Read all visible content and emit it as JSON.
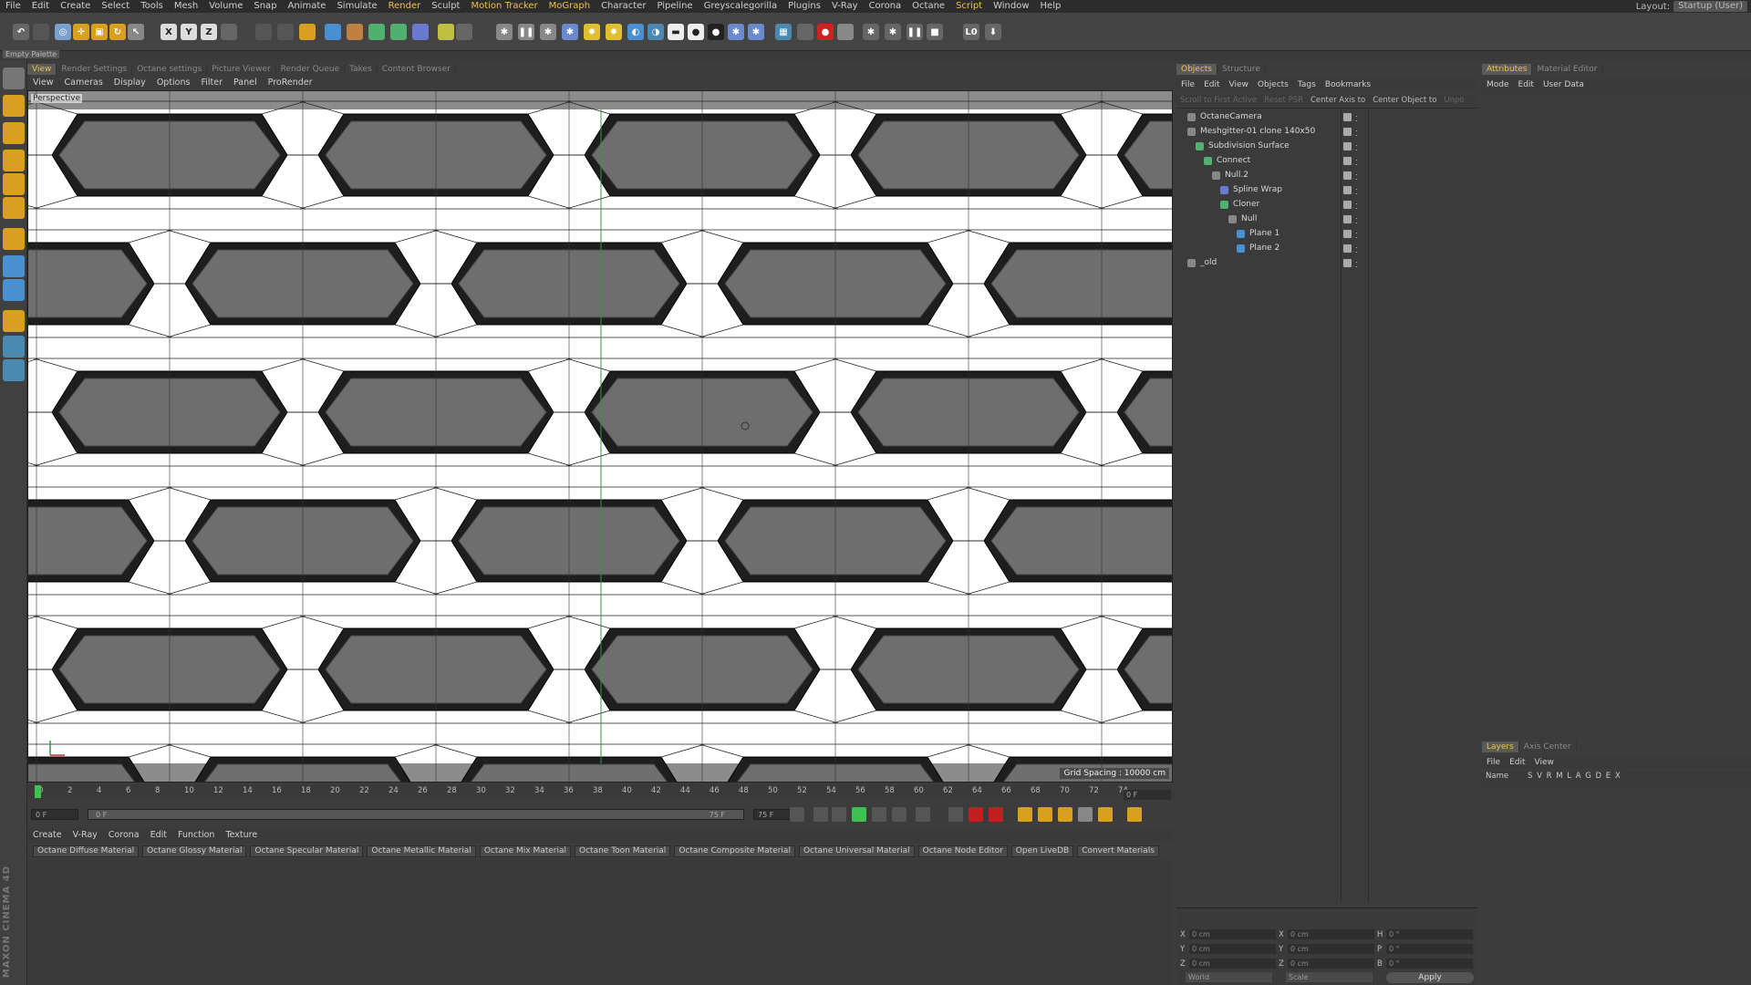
{
  "menubar": {
    "items": [
      "File",
      "Edit",
      "Create",
      "Select",
      "Tools",
      "Mesh",
      "Volume",
      "Snap",
      "Animate",
      "Simulate",
      "Render",
      "Sculpt",
      "Motion Tracker",
      "MoGraph",
      "Character",
      "Pipeline",
      "Greyscalegorilla",
      "Plugins",
      "V-Ray",
      "Corona",
      "Octane",
      "Script",
      "Window",
      "Help"
    ],
    "highlighted": [
      "Render",
      "Motion Tracker",
      "MoGraph",
      "Script"
    ],
    "layout_label": "Layout:",
    "layout_value": "Startup (User)"
  },
  "toolbar": {
    "axis_x": "X",
    "axis_y": "Y",
    "axis_z": "Z",
    "lock_label": "L0"
  },
  "palette": {
    "label": "Empty Palette"
  },
  "viewport": {
    "tabs": [
      "View",
      "Render Settings",
      "Octane settings",
      "Picture Viewer",
      "Render Queue",
      "Takes",
      "Content Browser"
    ],
    "active_tab": "View",
    "menu": [
      "View",
      "Cameras",
      "Display",
      "Options",
      "Filter",
      "Panel",
      "ProRender"
    ],
    "camera_label": "Perspective",
    "grid_info": "Grid Spacing : 10000 cm"
  },
  "timeline": {
    "ticks": [
      "0",
      "2",
      "4",
      "6",
      "8",
      "10",
      "12",
      "14",
      "16",
      "18",
      "20",
      "22",
      "24",
      "26",
      "28",
      "30",
      "32",
      "34",
      "36",
      "38",
      "40",
      "42",
      "44",
      "46",
      "48",
      "50",
      "52",
      "54",
      "56",
      "58",
      "60",
      "62",
      "64",
      "66",
      "68",
      "70",
      "72",
      "74"
    ],
    "current_frame": "0 F",
    "start_frame": "0 F",
    "slider_start": "0 F",
    "slider_end": "75 F",
    "end_frame": "75 F",
    "right_frame": "0 F"
  },
  "material": {
    "tabs": [
      "Create",
      "V-Ray",
      "Corona",
      "Edit",
      "Function",
      "Texture"
    ],
    "buttons": [
      "Octane Diffuse Material",
      "Octane Glossy Material",
      "Octane Specular Material",
      "Octane Metallic Material",
      "Octane Mix Material",
      "Octane Toon Material",
      "Octane Composite Material",
      "Octane Universal Material",
      "Octane Node Editor",
      "Open LiveDB",
      "Convert Materials"
    ]
  },
  "objects": {
    "tabs": [
      "Objects",
      "Structure"
    ],
    "active_tab": "Objects",
    "menu": [
      "File",
      "Edit",
      "View",
      "Objects",
      "Tags",
      "Bookmarks"
    ],
    "tools": [
      "Scroll to First Active",
      "Reset PSR",
      "Center Axis to",
      "Center Object to",
      "Unpo"
    ],
    "tree": [
      {
        "name": "OctaneCamera",
        "depth": 0,
        "icon": "camera-icon"
      },
      {
        "name": "Meshgitter-01 clone 140x50",
        "depth": 0,
        "icon": "null-icon"
      },
      {
        "name": "Subdivision Surface",
        "depth": 1,
        "icon": "subdivision-icon"
      },
      {
        "name": "Connect",
        "depth": 2,
        "icon": "connect-icon"
      },
      {
        "name": "Null.2",
        "depth": 3,
        "icon": "null-icon"
      },
      {
        "name": "Spline Wrap",
        "depth": 4,
        "icon": "spline-wrap-icon"
      },
      {
        "name": "Cloner",
        "depth": 4,
        "icon": "cloner-icon"
      },
      {
        "name": "Null",
        "depth": 5,
        "icon": "null-icon"
      },
      {
        "name": "Plane 1",
        "depth": 6,
        "icon": "plane-icon"
      },
      {
        "name": "Plane 2",
        "depth": 6,
        "icon": "plane-icon"
      },
      {
        "name": "_old",
        "depth": 0,
        "icon": "null-icon"
      }
    ]
  },
  "coords": {
    "pos_x": "0 cm",
    "pos_y": "0 cm",
    "pos_z": "0 cm",
    "size_x": "0 cm",
    "size_y": "0 cm",
    "size_z": "0 cm",
    "rot_h": "0 °",
    "rot_p": "0 °",
    "rot_b": "0 °",
    "mode_world": "World",
    "mode_scale": "Scale",
    "apply": "Apply",
    "lbl_x": "X",
    "lbl_y": "Y",
    "lbl_z": "Z",
    "lbl_h": "H",
    "lbl_p": "P",
    "lbl_b": "B"
  },
  "attributes": {
    "tabs": [
      "Attributes",
      "Material Editor"
    ],
    "active_tab": "Attributes",
    "menu": [
      "Mode",
      "Edit",
      "User Data"
    ]
  },
  "layers": {
    "tabs": [
      "Layers",
      "Axis Center"
    ],
    "active_tab": "Layers",
    "menu": [
      "File",
      "Edit",
      "View"
    ],
    "name_col": "Name",
    "flags": "S V R M L A G D E X"
  },
  "brand": {
    "text": "MAXON CINEMA 4D"
  },
  "colors": {
    "accent": "#f0c050",
    "viewport_bg": "#ffffff",
    "hole": "#6e6e6e"
  }
}
